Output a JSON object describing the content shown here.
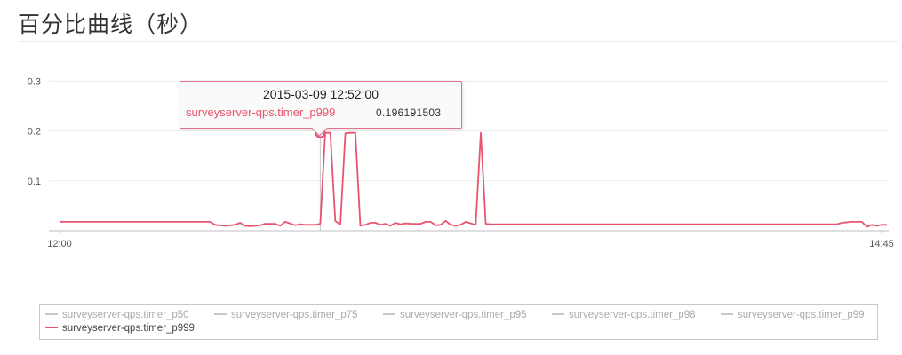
{
  "page": {
    "title": "百分比曲线（秒）"
  },
  "tooltip": {
    "date": "2015-03-09 12:52:00",
    "series": "surveyserver-qps.timer_p999",
    "value": "0.196191503"
  },
  "legend": {
    "items": [
      {
        "label": "surveyserver-qps.timer_p50",
        "active": false
      },
      {
        "label": "surveyserver-qps.timer_p75",
        "active": false
      },
      {
        "label": "surveyserver-qps.timer_p95",
        "active": false
      },
      {
        "label": "surveyserver-qps.timer_p98",
        "active": false
      },
      {
        "label": "surveyserver-qps.timer_p99",
        "active": false
      },
      {
        "label": "surveyserver-qps.timer_p999",
        "active": true
      }
    ]
  },
  "chart_data": {
    "type": "line",
    "title": "百分比曲线（秒）",
    "xlabel": "",
    "ylabel": "",
    "x_range": [
      "12:00",
      "14:45"
    ],
    "x_ticks": [
      "12:00",
      "14:45"
    ],
    "y_ticks": [
      "0.1",
      "0.2",
      "0.3"
    ],
    "ylim": [
      0,
      0.32
    ],
    "grid": true,
    "legend_position": "bottom",
    "colors": {
      "active": "#e8536f",
      "inactive": "#c7c7c7"
    },
    "series": [
      {
        "name": "surveyserver-qps.timer_p999",
        "color": "#e8536f",
        "x": [
          "12:00",
          "12:05",
          "12:10",
          "12:15",
          "12:20",
          "12:25",
          "12:29",
          "12:30",
          "12:31",
          "12:33",
          "12:35",
          "12:36",
          "12:37",
          "12:38",
          "12:40",
          "12:41",
          "12:42",
          "12:43",
          "12:44",
          "12:45",
          "12:47",
          "12:48",
          "12:49",
          "12:50",
          "12:51",
          "12:52",
          "12:53",
          "12:54",
          "12:55",
          "12:56",
          "12:57",
          "12:58",
          "12:59",
          "13:00",
          "13:01",
          "13:02",
          "13:03",
          "13:04",
          "13:05",
          "13:06",
          "13:07",
          "13:08",
          "13:09",
          "13:10",
          "13:11",
          "13:12",
          "13:13",
          "13:14",
          "13:15",
          "13:16",
          "13:17",
          "13:18",
          "13:19",
          "13:20",
          "13:21",
          "13:22",
          "13:23",
          "13:24",
          "13:25",
          "13:26",
          "13:27",
          "13:28",
          "13:29",
          "13:30",
          "13:32",
          "13:35",
          "13:40",
          "13:50",
          "14:00",
          "14:10",
          "14:20",
          "14:30",
          "14:35",
          "14:36",
          "14:38",
          "14:40",
          "14:41",
          "14:42",
          "14:43",
          "14:44",
          "14:45"
        ],
        "y": [
          0.018,
          0.018,
          0.018,
          0.018,
          0.018,
          0.018,
          0.018,
          0.018,
          0.012,
          0.01,
          0.012,
          0.016,
          0.01,
          0.009,
          0.011,
          0.014,
          0.014,
          0.014,
          0.01,
          0.018,
          0.011,
          0.013,
          0.012,
          0.012,
          0.012,
          0.014,
          0.196,
          0.196,
          0.02,
          0.012,
          0.195,
          0.196,
          0.196,
          0.01,
          0.012,
          0.016,
          0.016,
          0.012,
          0.014,
          0.01,
          0.016,
          0.013,
          0.015,
          0.014,
          0.014,
          0.014,
          0.018,
          0.018,
          0.011,
          0.012,
          0.02,
          0.012,
          0.01,
          0.012,
          0.018,
          0.015,
          0.012,
          0.196,
          0.014,
          0.013,
          0.013,
          0.013,
          0.013,
          0.013,
          0.013,
          0.013,
          0.013,
          0.013,
          0.013,
          0.013,
          0.013,
          0.013,
          0.013,
          0.016,
          0.018,
          0.018,
          0.008,
          0.012,
          0.01,
          0.012,
          0.012
        ]
      }
    ]
  }
}
